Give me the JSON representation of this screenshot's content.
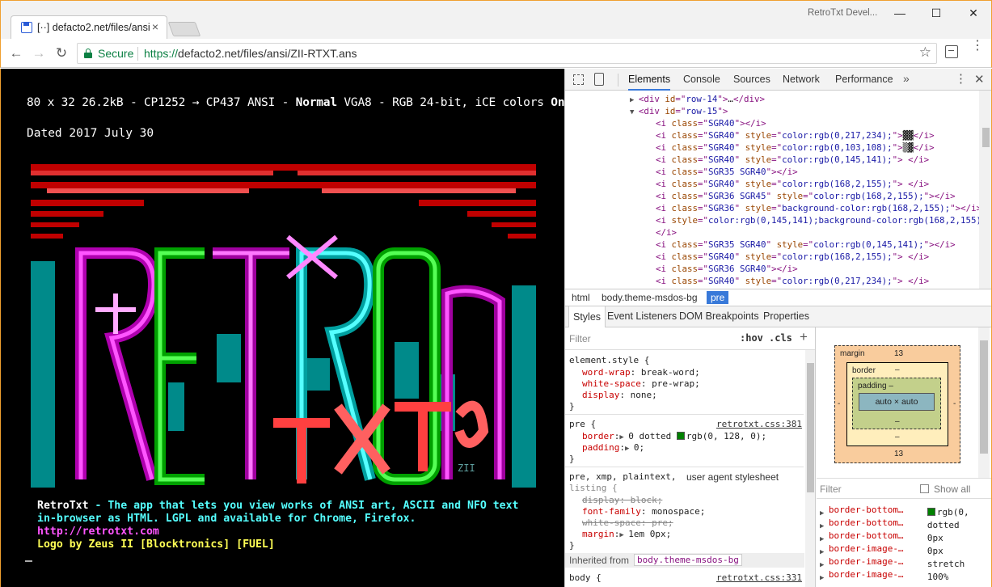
{
  "window": {
    "title": "RetroTxt Devel...",
    "controls": {
      "minimize": "—",
      "maximize": "☐",
      "close": "✕"
    }
  },
  "tab": {
    "title": "[··] defacto2.net/files/ansi",
    "close": "×"
  },
  "toolbar": {
    "back": "←",
    "forward": "→",
    "reload": "↻",
    "secure_label": "Secure",
    "url_scheme": "https://",
    "url_rest": "defacto2.net/files/ansi/ZII-RTXT.ans",
    "bookmark": "☆",
    "menu": "⋮"
  },
  "page": {
    "meta_prefix": "80 x 32 26.2kB - CP1252 → CP437 ANSI - ",
    "meta_mode": "Normal",
    "meta_middle": " VGA8 - RGB 24-bit, iCE colors ",
    "meta_ice": "On",
    "date": "Dated 2017 July 30",
    "art_signature": "ZII",
    "info": {
      "line1_name": "RetroTxt",
      "line1_rest": " - The app that lets you view works of ANSI art, ASCII and NFO text",
      "line2": "in-browser as HTML. LGPL and available for Chrome, Firefox.",
      "url": "http://retrotxt.com",
      "credit": "Logo by Zeus II [Blocktronics] [FUEL]"
    },
    "colors": {
      "background": "#000000",
      "cyan": "#55ffff",
      "magenta": "#ff55ff",
      "yellow": "#ffff55"
    }
  },
  "devtools": {
    "tabs": [
      "Elements",
      "Console",
      "Sources",
      "Network",
      "Performance"
    ],
    "more": "»",
    "kebab": "⋮",
    "close": "✕",
    "dom": [
      {
        "indent": 4,
        "tri": "▶",
        "parts": [
          [
            "tag",
            "<div "
          ],
          [
            "attr",
            "id"
          ],
          [
            "tag",
            "=\""
          ],
          [
            "val",
            "row-14"
          ],
          [
            "tag",
            "\">"
          ],
          [
            "txt",
            "…"
          ],
          [
            "tag",
            "</div>"
          ]
        ]
      },
      {
        "indent": 4,
        "tri": "▼",
        "parts": [
          [
            "tag",
            "<div "
          ],
          [
            "attr",
            "id"
          ],
          [
            "tag",
            "=\""
          ],
          [
            "val",
            "row-15"
          ],
          [
            "tag",
            "\">"
          ]
        ]
      },
      {
        "indent": 6,
        "tri": "",
        "parts": [
          [
            "tag",
            "<i "
          ],
          [
            "attr",
            "class"
          ],
          [
            "tag",
            "=\""
          ],
          [
            "val",
            "SGR40"
          ],
          [
            "tag",
            "\"></i>"
          ]
        ]
      },
      {
        "indent": 6,
        "tri": "",
        "parts": [
          [
            "tag",
            "<i "
          ],
          [
            "attr",
            "class"
          ],
          [
            "tag",
            "=\""
          ],
          [
            "val",
            "SGR40"
          ],
          [
            "tag",
            "\" "
          ],
          [
            "attr",
            "style"
          ],
          [
            "tag",
            "=\""
          ],
          [
            "val",
            "color:rgb(0,217,234);"
          ],
          [
            "tag",
            "\">"
          ],
          [
            "txt",
            "▓▓"
          ],
          [
            "tag",
            "</i>"
          ]
        ]
      },
      {
        "indent": 6,
        "tri": "",
        "parts": [
          [
            "tag",
            "<i "
          ],
          [
            "attr",
            "class"
          ],
          [
            "tag",
            "=\""
          ],
          [
            "val",
            "SGR40"
          ],
          [
            "tag",
            "\" "
          ],
          [
            "attr",
            "style"
          ],
          [
            "tag",
            "=\""
          ],
          [
            "val",
            "color:rgb(0,103,108);"
          ],
          [
            "tag",
            "\">"
          ],
          [
            "txt",
            "▒▓"
          ],
          [
            "tag",
            "</i>"
          ]
        ]
      },
      {
        "indent": 6,
        "tri": "",
        "parts": [
          [
            "tag",
            "<i "
          ],
          [
            "attr",
            "class"
          ],
          [
            "tag",
            "=\""
          ],
          [
            "val",
            "SGR40"
          ],
          [
            "tag",
            "\" "
          ],
          [
            "attr",
            "style"
          ],
          [
            "tag",
            "=\""
          ],
          [
            "val",
            "color:rgb(0,145,141);"
          ],
          [
            "tag",
            "\"> </i>"
          ]
        ]
      },
      {
        "indent": 6,
        "tri": "",
        "parts": [
          [
            "tag",
            "<i "
          ],
          [
            "attr",
            "class"
          ],
          [
            "tag",
            "=\""
          ],
          [
            "val",
            "SGR35 SGR40"
          ],
          [
            "tag",
            "\"></i>"
          ]
        ]
      },
      {
        "indent": 6,
        "tri": "",
        "parts": [
          [
            "tag",
            "<i "
          ],
          [
            "attr",
            "class"
          ],
          [
            "tag",
            "=\""
          ],
          [
            "val",
            "SGR40"
          ],
          [
            "tag",
            "\" "
          ],
          [
            "attr",
            "style"
          ],
          [
            "tag",
            "=\""
          ],
          [
            "val",
            "color:rgb(168,2,155);"
          ],
          [
            "tag",
            "\"> </i>"
          ]
        ]
      },
      {
        "indent": 6,
        "tri": "",
        "parts": [
          [
            "tag",
            "<i "
          ],
          [
            "attr",
            "class"
          ],
          [
            "tag",
            "=\""
          ],
          [
            "val",
            "SGR36 SGR45"
          ],
          [
            "tag",
            "\" "
          ],
          [
            "attr",
            "style"
          ],
          [
            "tag",
            "=\""
          ],
          [
            "val",
            "color:rgb(168,2,155);"
          ],
          [
            "tag",
            "\"></i>"
          ]
        ]
      },
      {
        "indent": 6,
        "tri": "",
        "parts": [
          [
            "tag",
            "<i "
          ],
          [
            "attr",
            "class"
          ],
          [
            "tag",
            "=\""
          ],
          [
            "val",
            "SGR36"
          ],
          [
            "tag",
            "\" "
          ],
          [
            "attr",
            "style"
          ],
          [
            "tag",
            "=\""
          ],
          [
            "val",
            "background-color:rgb(168,2,155);"
          ],
          [
            "tag",
            "\"></i>"
          ]
        ]
      },
      {
        "indent": 6,
        "tri": "",
        "parts": [
          [
            "tag",
            "<i "
          ],
          [
            "attr",
            "style"
          ],
          [
            "tag",
            "=\""
          ],
          [
            "val",
            "color:rgb(0,145,141);background-color:rgb(168,2,155);"
          ],
          [
            "tag",
            "\">"
          ]
        ]
      },
      {
        "indent": 6,
        "tri": "",
        "parts": [
          [
            "tag",
            "</i>"
          ]
        ]
      },
      {
        "indent": 6,
        "tri": "",
        "parts": [
          [
            "tag",
            "<i "
          ],
          [
            "attr",
            "class"
          ],
          [
            "tag",
            "=\""
          ],
          [
            "val",
            "SGR35 SGR40"
          ],
          [
            "tag",
            "\" "
          ],
          [
            "attr",
            "style"
          ],
          [
            "tag",
            "=\""
          ],
          [
            "val",
            "color:rgb(0,145,141);"
          ],
          [
            "tag",
            "\"></i>"
          ]
        ]
      },
      {
        "indent": 6,
        "tri": "",
        "parts": [
          [
            "tag",
            "<i "
          ],
          [
            "attr",
            "class"
          ],
          [
            "tag",
            "=\""
          ],
          [
            "val",
            "SGR40"
          ],
          [
            "tag",
            "\" "
          ],
          [
            "attr",
            "style"
          ],
          [
            "tag",
            "=\""
          ],
          [
            "val",
            "color:rgb(168,2,155);"
          ],
          [
            "tag",
            "\"> </i>"
          ]
        ]
      },
      {
        "indent": 6,
        "tri": "",
        "parts": [
          [
            "tag",
            "<i "
          ],
          [
            "attr",
            "class"
          ],
          [
            "tag",
            "=\""
          ],
          [
            "val",
            "SGR36 SGR40"
          ],
          [
            "tag",
            "\"></i>"
          ]
        ]
      },
      {
        "indent": 6,
        "tri": "",
        "parts": [
          [
            "tag",
            "<i "
          ],
          [
            "attr",
            "class"
          ],
          [
            "tag",
            "=\""
          ],
          [
            "val",
            "SGR40"
          ],
          [
            "tag",
            "\" "
          ],
          [
            "attr",
            "style"
          ],
          [
            "tag",
            "=\""
          ],
          [
            "val",
            "color:rgb(0,217,234);"
          ],
          [
            "tag",
            "\">   </i>"
          ]
        ]
      }
    ],
    "breadcrumbs": [
      "html",
      "body.theme-msdos-bg",
      "pre"
    ],
    "sub_tabs": [
      "Styles",
      "Event Listeners",
      "DOM Breakpoints",
      "Properties"
    ],
    "styles": {
      "filter_placeholder": "Filter",
      "hov": ":hov",
      "cls": ".cls",
      "plus": "+",
      "element_style_selector": "element.style {",
      "element_style_props": [
        {
          "name": "word-wrap",
          "value": "break-word;"
        },
        {
          "name": "white-space",
          "value": "pre-wrap;"
        },
        {
          "name": "display",
          "value": "none;"
        }
      ],
      "pre_selector": "pre {",
      "pre_source": "retrotxt.css:381",
      "pre_border_name": "border",
      "pre_border_value": "0 dotted",
      "pre_border_color": "rgb(0, 128, 0);",
      "pre_padding_name": "padding",
      "pre_padding_value": "0;",
      "ua_selector": "pre, xmp, plaintext,",
      "ua_selector2": "listing {",
      "ua_source": "user agent stylesheet",
      "ua_props": [
        {
          "name": "display",
          "value": "block;",
          "struck": true
        },
        {
          "name": "font-family",
          "value": "monospace;",
          "struck": false
        },
        {
          "name": "white-space",
          "value": "pre;",
          "struck": true
        },
        {
          "name": "margin",
          "value": "1em 0px;",
          "struck": false
        }
      ],
      "inherited_label": "Inherited from",
      "inherited_from": "body.theme-msdos-bg",
      "body_selector": "body {",
      "body_source": "retrotxt.css:331",
      "close_brace": "}"
    },
    "box_model": {
      "margin_label": "margin",
      "margin_top": "13",
      "margin_bottom": "13",
      "margin_side": "-",
      "border_label": "border",
      "border_value": "–",
      "padding_label": "padding",
      "padding_value": "–",
      "content": "auto × auto"
    },
    "computed": {
      "filter_placeholder": "Filter",
      "show_all": "Show all",
      "items": [
        {
          "name": "border-bottom…",
          "value": "rgb(0,"
        },
        {
          "name": "border-bottom…",
          "value": "dotted"
        },
        {
          "name": "border-bottom…",
          "value": "0px"
        },
        {
          "name": "border-image-…",
          "value": "0px"
        },
        {
          "name": "border-image-…",
          "value": "stretch"
        },
        {
          "name": "border-image-…",
          "value": "100%"
        }
      ]
    }
  }
}
